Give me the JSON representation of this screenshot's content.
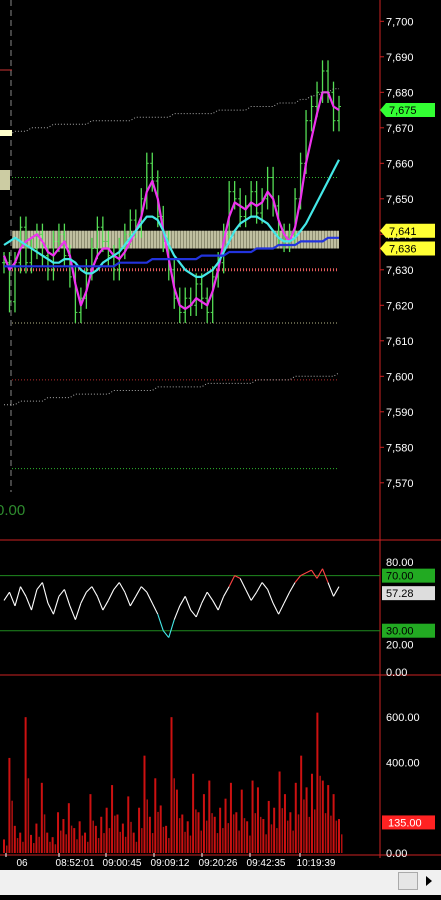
{
  "chart_data": [
    {
      "type": "line",
      "panel": "price",
      "ylim": [
        7566,
        7706
      ],
      "y_ticks": [
        "7,700",
        "7,690",
        "7,680",
        "7,670",
        "7,660",
        "7,650",
        "7,640",
        "7,630",
        "7,620",
        "7,610",
        "7,600",
        "7,590",
        "7,580",
        "7,570"
      ],
      "y_tick_values": [
        7700,
        7690,
        7680,
        7670,
        7660,
        7650,
        7640,
        7630,
        7620,
        7610,
        7600,
        7590,
        7580,
        7570
      ],
      "price_labels": [
        {
          "text": "7,675",
          "value": 7675,
          "color": "#33ff33"
        },
        {
          "text": "7,641",
          "value": 7641,
          "color": "#ffff33"
        },
        {
          "text": "7,636",
          "value": 7636,
          "color": "#ffff33"
        }
      ],
      "overlay_text": "0.00",
      "series": [
        {
          "values": [
            7632,
            7621,
            7632,
            7642,
            7632,
            7636,
            7640,
            7634,
            7630,
            7638,
            7640,
            7634,
            7628,
            7618,
            7622,
            7630,
            7636,
            7642,
            7638,
            7634,
            7630,
            7636,
            7640,
            7644,
            7642,
            7650,
            7660,
            7655,
            7645,
            7638,
            7630,
            7622,
            7618,
            7622,
            7620,
            7626,
            7622,
            7618,
            7628,
            7632,
            7640,
            7652,
            7650,
            7645,
            7648,
            7652,
            7646,
            7650,
            7656,
            7648,
            7640,
            7638,
            7640,
            7650,
            7660,
            7672,
            7676,
            7680,
            7686,
            7680,
            7672,
            7676
          ]
        },
        {
          "values": [
            7634,
            7630,
            7632,
            7636,
            7638,
            7639,
            7640,
            7638,
            7635,
            7634,
            7636,
            7638,
            7634,
            7626,
            7620,
            7624,
            7630,
            7634,
            7636,
            7636,
            7634,
            7633,
            7635,
            7638,
            7641,
            7645,
            7652,
            7655,
            7650,
            7641,
            7633,
            7625,
            7620,
            7619,
            7620,
            7622,
            7621,
            7620,
            7624,
            7630,
            7638,
            7645,
            7649,
            7648,
            7647,
            7649,
            7648,
            7649,
            7652,
            7650,
            7644,
            7640,
            7638,
            7642,
            7650,
            7660,
            7667,
            7674,
            7680,
            7680,
            7676,
            7675
          ]
        },
        {
          "values": [
            7637,
            7638,
            7639,
            7638,
            7637,
            7636,
            7635,
            7634,
            7633,
            7632,
            7632,
            7633,
            7633,
            7632,
            7630,
            7629,
            7629,
            7630,
            7632,
            7633,
            7634,
            7635,
            7637,
            7639,
            7641,
            7643,
            7645,
            7645,
            7644,
            7641,
            7637,
            7634,
            7632,
            7630,
            7629,
            7628,
            7628,
            7629,
            7630,
            7632,
            7635,
            7638,
            7641,
            7643,
            7644,
            7645,
            7645,
            7644,
            7643,
            7641,
            7639,
            7638,
            7638,
            7639,
            7641,
            7643,
            7646,
            7649,
            7652,
            7655,
            7658,
            7661
          ]
        },
        {
          "values": [
            7631,
            7631,
            7631,
            7631,
            7631,
            7631,
            7631,
            7631,
            7631,
            7631,
            7631,
            7631,
            7631,
            7631,
            7631,
            7631,
            7631,
            7631,
            7631,
            7631,
            7631,
            7632,
            7632,
            7632,
            7632,
            7632,
            7632,
            7633,
            7633,
            7633,
            7633,
            7633,
            7633,
            7633,
            7633,
            7633,
            7634,
            7634,
            7634,
            7634,
            7634,
            7635,
            7635,
            7635,
            7635,
            7635,
            7636,
            7636,
            7636,
            7636,
            7637,
            7637,
            7637,
            7637,
            7638,
            7638,
            7638,
            7638,
            7638,
            7639,
            7639,
            7639
          ]
        },
        {
          "values": [
            7668,
            7668,
            7669,
            7669,
            7669,
            7670,
            7670,
            7670,
            7670,
            7671,
            7671,
            7671,
            7671,
            7671,
            7671,
            7671,
            7672,
            7672,
            7672,
            7672,
            7672,
            7672,
            7672,
            7672,
            7673,
            7673,
            7673,
            7673,
            7673,
            7673,
            7673,
            7674,
            7674,
            7674,
            7674,
            7674,
            7674,
            7674,
            7674,
            7675,
            7675,
            7675,
            7675,
            7675,
            7675,
            7676,
            7676,
            7676,
            7676,
            7676,
            7677,
            7677,
            7677,
            7677,
            7678,
            7678,
            7679,
            7679,
            7680,
            7680,
            7681,
            7681
          ]
        },
        {
          "values": [
            7592,
            7592,
            7592,
            7593,
            7593,
            7593,
            7593,
            7593,
            7594,
            7594,
            7594,
            7594,
            7594,
            7595,
            7595,
            7595,
            7595,
            7595,
            7595,
            7595,
            7596,
            7596,
            7596,
            7596,
            7596,
            7596,
            7596,
            7596,
            7597,
            7597,
            7597,
            7597,
            7597,
            7597,
            7597,
            7597,
            7597,
            7598,
            7598,
            7598,
            7598,
            7598,
            7598,
            7598,
            7598,
            7598,
            7599,
            7599,
            7599,
            7599,
            7599,
            7599,
            7599,
            7600,
            7600,
            7600,
            7600,
            7600,
            7600,
            7600,
            7600,
            7601
          ]
        }
      ],
      "levels": [
        {
          "value": 7656,
          "color": "#33cc33",
          "style": "dotted"
        },
        {
          "value": 7615,
          "color": "#cccc99",
          "style": "dotted"
        },
        {
          "value": 7574,
          "color": "#33cc33",
          "style": "dotted"
        },
        {
          "value": 7630,
          "color": "#ff6666",
          "style": "dotted"
        },
        {
          "value": 7599,
          "color": "#cc3333",
          "style": "dotted"
        }
      ],
      "zones": [
        {
          "from": 7636,
          "to": 7641,
          "color": "#ffffcc"
        }
      ]
    },
    {
      "type": "line",
      "panel": "oscillator",
      "ylim": [
        0,
        85
      ],
      "y_ticks": [
        "80.00",
        "20.00",
        "0.00"
      ],
      "y_tick_values": [
        80,
        20,
        0
      ],
      "bands": [
        70,
        30
      ],
      "value_labels": [
        {
          "text": "70.00",
          "value": 70,
          "color": "#22aa22"
        },
        {
          "text": "57.28",
          "value": 57.28,
          "color": "#dddddd"
        },
        {
          "text": "30.00",
          "value": 30,
          "color": "#22aa22"
        }
      ],
      "series": [
        {
          "values": [
            52,
            58,
            48,
            62,
            55,
            45,
            60,
            65,
            50,
            42,
            55,
            60,
            48,
            38,
            50,
            58,
            62,
            55,
            45,
            52,
            60,
            65,
            58,
            48,
            55,
            62,
            58,
            50,
            42,
            30,
            25,
            38,
            48,
            55,
            45,
            40,
            50,
            58,
            52,
            45,
            55,
            62,
            70,
            68,
            60,
            52,
            58,
            65,
            60,
            50,
            42,
            50,
            58,
            65,
            70,
            72,
            74,
            68,
            75,
            65,
            55,
            62
          ]
        }
      ]
    },
    {
      "type": "bar",
      "panel": "volume",
      "ylim": [
        0,
        720
      ],
      "y_ticks": [
        "600.00",
        "400.00",
        "0.00"
      ],
      "y_tick_values": [
        600,
        400,
        0
      ],
      "value_labels": [
        {
          "text": "135.00",
          "value": 135,
          "color": "#ff2222"
        }
      ],
      "values": [
        60,
        420,
        120,
        90,
        600,
        80,
        130,
        310,
        90,
        70,
        180,
        150,
        220,
        110,
        140,
        90,
        260,
        120,
        160,
        200,
        300,
        170,
        130,
        250,
        90,
        200,
        430,
        160,
        330,
        210,
        120,
        600,
        280,
        170,
        140,
        350,
        180,
        260,
        320,
        160,
        200,
        240,
        310,
        180,
        280,
        140,
        320,
        290,
        150,
        230,
        200,
        360,
        260,
        180,
        310,
        430,
        290,
        350,
        620,
        320,
        300,
        260,
        150
      ]
    },
    {
      "type": "table",
      "panel": "time-axis",
      "x_ticks": [
        "06",
        "08:52:01",
        "09:00:45",
        "09:09:12",
        "09:20:26",
        "09:42:35",
        "10:19:39"
      ]
    }
  ]
}
